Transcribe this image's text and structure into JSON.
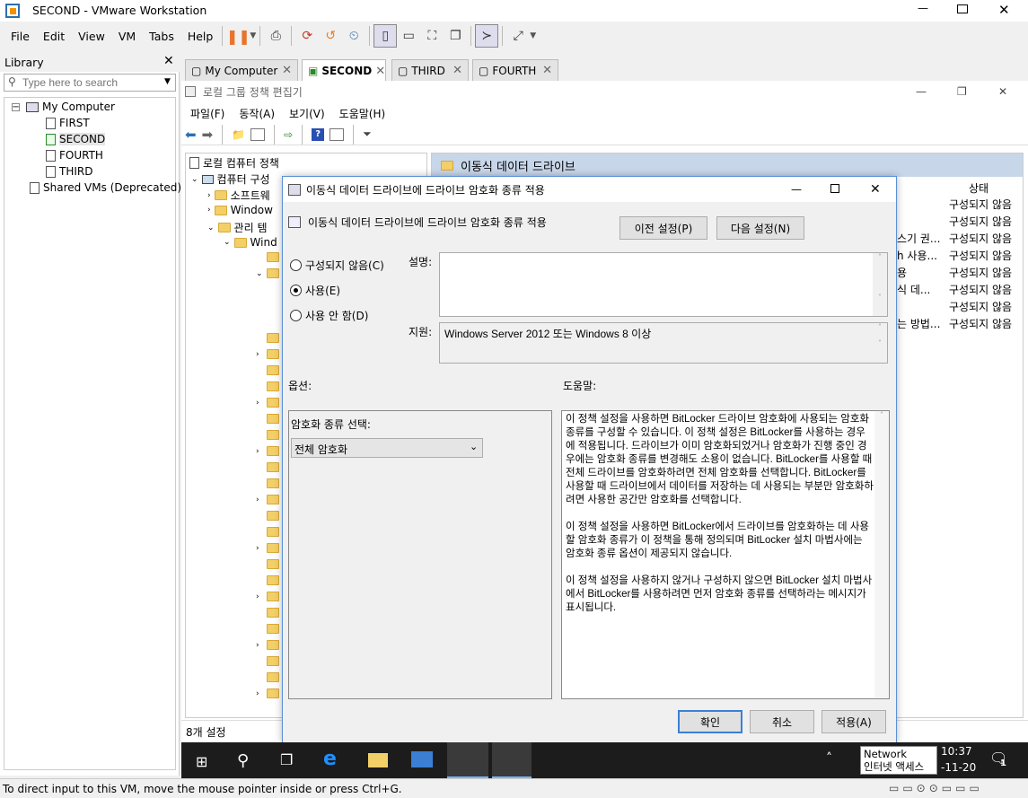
{
  "window": {
    "title": "SECOND - VMware Workstation"
  },
  "menubar": [
    "File",
    "Edit",
    "View",
    "VM",
    "Tabs",
    "Help"
  ],
  "library": {
    "title": "Library",
    "search_placeholder": "Type here to search",
    "tree": {
      "root": "My Computer",
      "vms": [
        "FIRST",
        "SECOND",
        "FOURTH",
        "THIRD"
      ],
      "shared": "Shared VMs (Deprecated)"
    }
  },
  "tabs": [
    "My Computer",
    "SECOND",
    "THIRD",
    "FOURTH"
  ],
  "gpedit": {
    "title": "로컬 그룹 정책 편집기",
    "menu": [
      "파일(F)",
      "동작(A)",
      "보기(V)",
      "도움말(H)"
    ],
    "tree_root": "로컬 컴퓨터 정책",
    "tree_items": [
      "컴퓨터 구성",
      "소프트웨",
      "Window",
      "관리 템",
      "Wind"
    ],
    "right_header": "이동식 데이터 드라이브",
    "state_header": "상태",
    "state_values": [
      "구성되지 않음",
      "구성되지 않음",
      "구성되지 않음",
      "구성되지 않음",
      "구성되지 않음",
      "구성되지 않음",
      "구성되지 않음",
      "구성되지 않음"
    ],
    "partial_rows": [
      "스기 권...",
      "h 사용...",
      "용",
      "식 데...",
      "",
      "는 방법..."
    ],
    "status": "8개 설정"
  },
  "dialog": {
    "title": "이동식 데이터 드라이브에 드라이브 암호화 종류 적용",
    "heading": "이동식 데이터 드라이브에 드라이브 암호화 종류 적용",
    "prev_button": "이전 설정(P)",
    "next_button": "다음 설정(N)",
    "radios": [
      "구성되지 않음(C)",
      "사용(E)",
      "사용 안 함(D)"
    ],
    "selected_radio": "사용(E)",
    "description_label": "설명:",
    "support_label": "지원:",
    "support_text": "Windows Server 2012 또는 Windows 8 이상",
    "options_label": "옵션:",
    "help_label": "도움말:",
    "option_field_label": "암호화 종류 선택:",
    "option_value": "전체 암호화",
    "help_p1": "이 정책 설정을 사용하면 BitLocker 드라이브 암호화에 사용되는 암호화 종류를 구성할 수 있습니다. 이 정책 설정은 BitLocker를 사용하는 경우에 적용됩니다. 드라이브가 이미 암호화되었거나 암호화가 진행 중인 경우에는 암호화 종류를 변경해도 소용이 없습니다. BitLocker를 사용할 때 전체 드라이브를 암호화하려면 전체 암호화를 선택합니다. BitLocker를 사용할 때 드라이브에서 데이터를 저장하는 데 사용되는 부분만 암호화하려면 사용한 공간만 암호화를 선택합니다.",
    "help_p2": "이 정책 설정을 사용하면 BitLocker에서 드라이브를 암호화하는 데 사용할 암호화 종류가 이 정책을 통해 정의되며 BitLocker 설치 마법사에는 암호화 종류 옵션이 제공되지 않습니다.",
    "help_p3": "이 정책 설정을 사용하지 않거나 구성하지 않으면 BitLocker 설치 마법사에서 BitLocker를 사용하려면 먼저 암호화 종류를 선택하라는 메시지가 표시됩니다.",
    "ok": "확인",
    "cancel": "취소",
    "apply": "적용(A)"
  },
  "taskbar": {
    "tooltip_line1": "Network",
    "tooltip_line2": "인터넷 액세스",
    "time": "10:37",
    "date": "-11-20",
    "notif_count": "1"
  },
  "vm_status": "To direct input to this VM, move the mouse pointer inside or press Ctrl+G."
}
